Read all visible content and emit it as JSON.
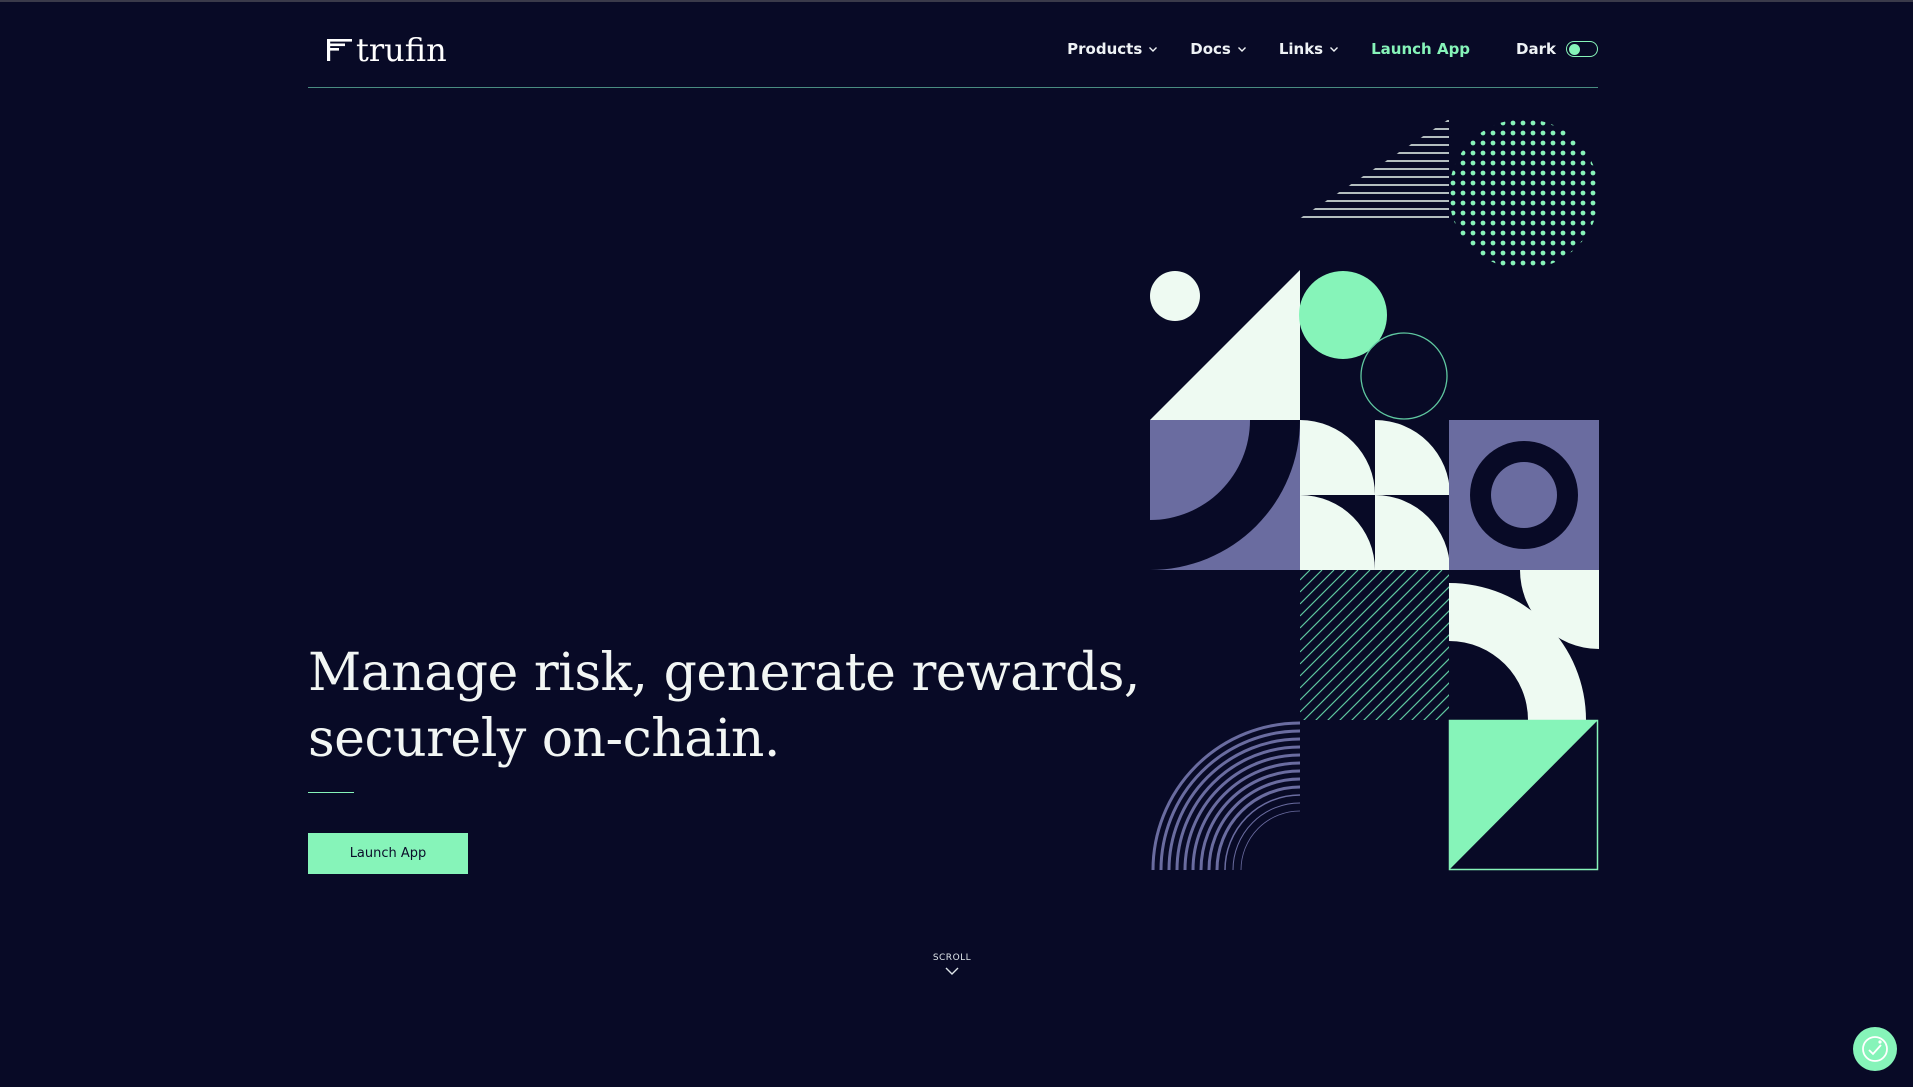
{
  "brand": {
    "name": "trufin",
    "logo_icon": "trufin-logo-mark"
  },
  "nav": {
    "items": [
      {
        "label": "Products",
        "icon": "chevron-down-icon"
      },
      {
        "label": "Docs",
        "icon": "chevron-down-icon"
      },
      {
        "label": "Links",
        "icon": "chevron-down-icon"
      }
    ],
    "launch_label": "Launch App",
    "theme_label": "Dark",
    "theme_toggle_on": true
  },
  "hero": {
    "heading_line1": "Manage risk, generate rewards,",
    "heading_line2": "securely on-chain.",
    "button_label": "Launch App"
  },
  "scroll": {
    "label": "SCROLL",
    "icon": "chevron-down-icon"
  },
  "fab": {
    "icon": "cookie-settings-icon"
  },
  "colors": {
    "background": "#080a26",
    "accent": "#86f4b9",
    "cream": "#eefaf2",
    "lavender": "#6a6ca0",
    "text": "#f2f6f4"
  }
}
